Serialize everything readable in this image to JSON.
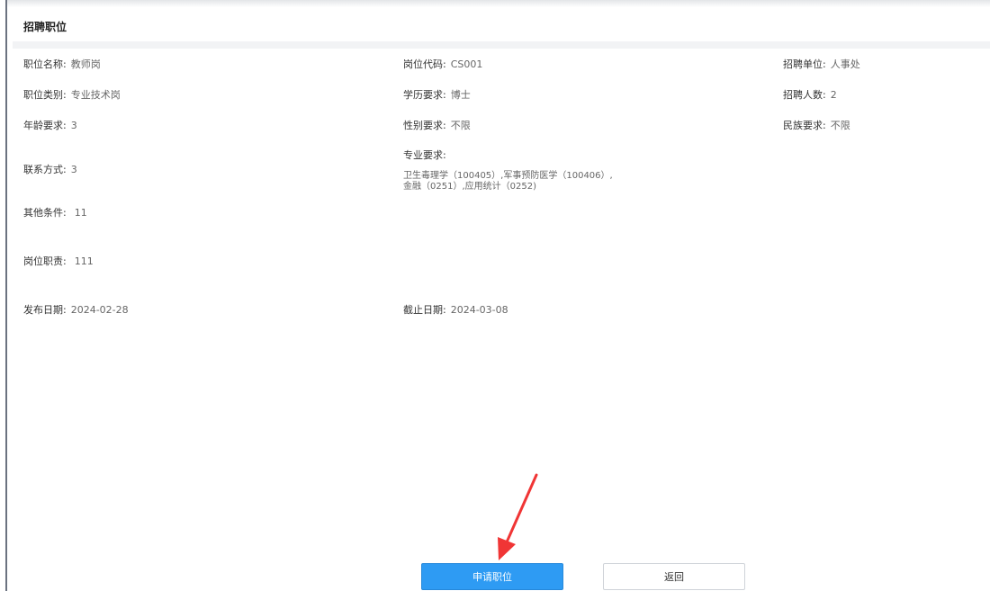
{
  "section": {
    "title": "招聘职位"
  },
  "fields": {
    "position_name": {
      "label": "职位名称:",
      "value": "教师岗"
    },
    "position_code": {
      "label": "岗位代码:",
      "value": "CS001"
    },
    "recruit_unit": {
      "label": "招聘单位:",
      "value": "人事处"
    },
    "position_category": {
      "label": "职位类别:",
      "value": "专业技术岗"
    },
    "education": {
      "label": "学历要求:",
      "value": "博士"
    },
    "recruit_count": {
      "label": "招聘人数:",
      "value": "2"
    },
    "age": {
      "label": "年龄要求:",
      "value": "3"
    },
    "gender": {
      "label": "性别要求:",
      "value": "不限"
    },
    "ethnicity": {
      "label": "民族要求:",
      "value": "不限"
    },
    "contact": {
      "label": "联系方式:",
      "value": "3"
    },
    "major": {
      "label": "专业要求:",
      "value": "卫生毒理学（100405）,军事预防医学（100406）,金融（0251）,应用统计（0252)"
    },
    "other_conditions": {
      "label": "其他条件:",
      "value": "11"
    },
    "duties": {
      "label": "岗位职责:",
      "value": "111"
    },
    "publish_date": {
      "label": "发布日期:",
      "value": "2024-02-28"
    },
    "deadline": {
      "label": "截止日期:",
      "value": "2024-03-08"
    }
  },
  "actions": {
    "apply_label": "申请职位",
    "back_label": "返回"
  },
  "annotation": {
    "arrow_color": "#f03535"
  },
  "colors": {
    "primary": "#2e9bf3",
    "text": "#333333",
    "muted": "#666666"
  }
}
